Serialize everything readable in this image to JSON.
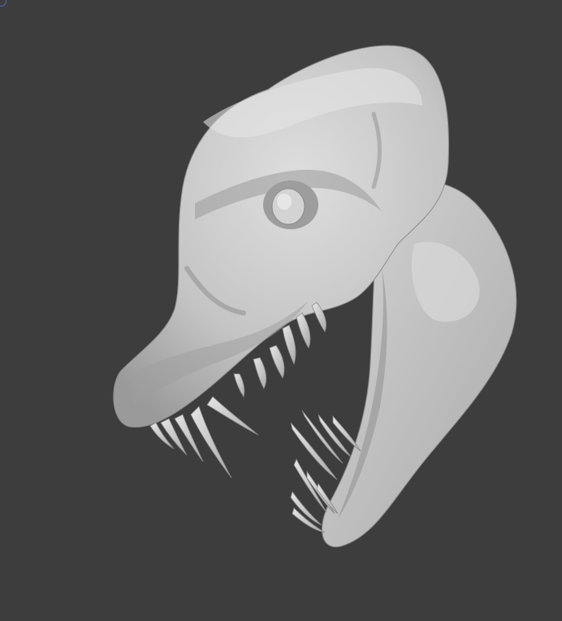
{
  "viewport": {
    "background_color": "#3d3d3d",
    "model_color": "#c9c9c9",
    "model_shadow_color": "#8f8f8f",
    "model_highlight_color": "#e2e2e2",
    "corner_gizmo_color": "#4a6fb8"
  },
  "model": {
    "icon": "creature-skull-sculpt"
  }
}
